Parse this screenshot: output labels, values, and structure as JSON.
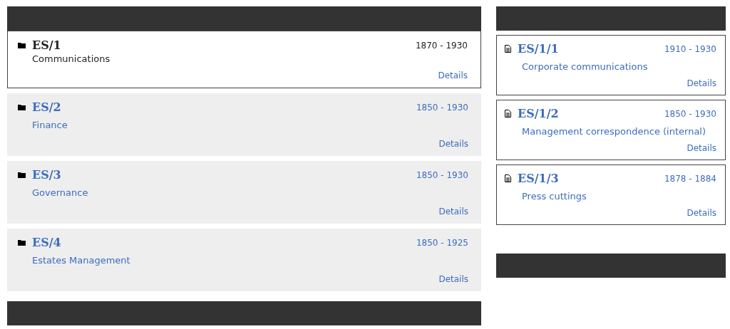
{
  "series": [
    {
      "kind": "folder",
      "reference": "ES/1",
      "title": "Communications",
      "dates": "1870 - 1930",
      "link": "Details",
      "selected": true
    },
    {
      "kind": "folder",
      "reference": "ES/2",
      "title": "Finance",
      "dates": "1850 - 1930",
      "link": "Details",
      "selected": false
    },
    {
      "kind": "folder",
      "reference": "ES/3",
      "title": "Governance",
      "dates": "1850 - 1930",
      "link": "Details",
      "selected": false
    },
    {
      "kind": "folder",
      "reference": "ES/4",
      "title": "Estates Management",
      "dates": "1850 - 1925",
      "link": "Details",
      "selected": false
    }
  ],
  "files": [
    {
      "kind": "file",
      "reference": "ES/1/1",
      "title": "Corporate communications",
      "dates": "1910 - 1930",
      "link": "Details"
    },
    {
      "kind": "file",
      "reference": "ES/1/2",
      "title": "Management correspondence (internal)",
      "dates": "1850 - 1930",
      "link": "Details"
    },
    {
      "kind": "file",
      "reference": "ES/1/3",
      "title": "Press cuttings",
      "dates": "1878 - 1884",
      "link": "Details"
    }
  ]
}
